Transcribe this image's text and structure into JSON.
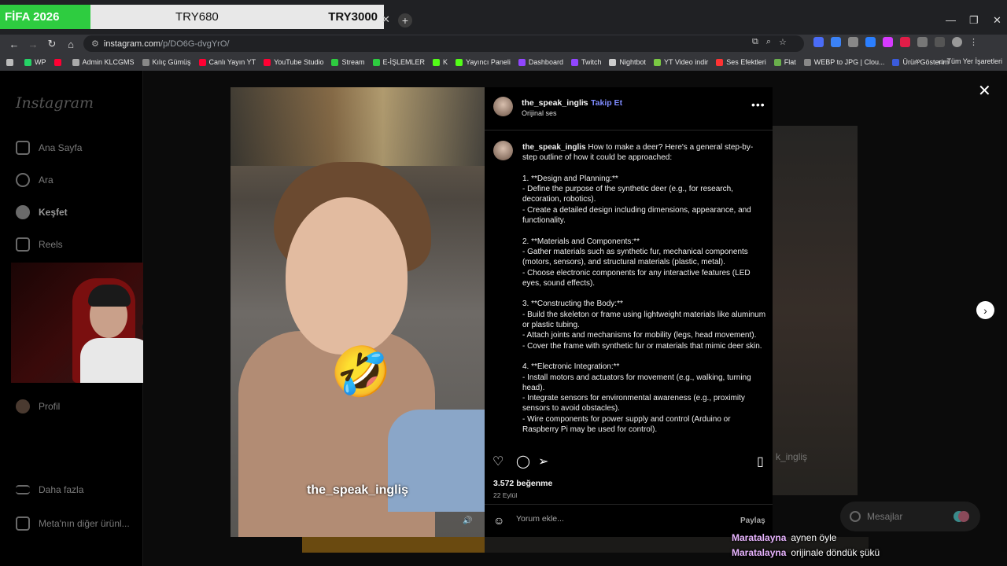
{
  "overlay": {
    "game": "FİFA 2026",
    "price1": "TRY680",
    "price2": "TRY3000"
  },
  "browser": {
    "url_host": "instagram.com",
    "url_path": "/p/DO6G-dvgYrO/",
    "bookmarks": [
      {
        "label": "WP",
        "color": "#25d366"
      },
      {
        "label": "",
        "color": "#ff0033"
      },
      {
        "label": "Admin KLCGMS",
        "color": "#aaaaaa"
      },
      {
        "label": "Kılıç Gümüş",
        "color": "#888888"
      },
      {
        "label": "Canlı Yayın YT",
        "color": "#ff0033"
      },
      {
        "label": "YouTube Studio",
        "color": "#ff0033"
      },
      {
        "label": "Stream",
        "color": "#2ecc40"
      },
      {
        "label": "E-İŞLEMLER",
        "color": "#2ecc40"
      },
      {
        "label": "K",
        "color": "#53fc18"
      },
      {
        "label": "Yayıncı Paneli",
        "color": "#53fc18"
      },
      {
        "label": "Dashboard",
        "color": "#9146ff"
      },
      {
        "label": "Twitch",
        "color": "#9146ff"
      },
      {
        "label": "Nightbot",
        "color": "#cccccc"
      },
      {
        "label": "YT Video indir",
        "color": "#7ac943"
      },
      {
        "label": "Ses Efektleri",
        "color": "#ff3333"
      },
      {
        "label": "Flat",
        "color": "#6ab04c"
      },
      {
        "label": "WEBP to JPG | Clou...",
        "color": "#888888"
      },
      {
        "label": "Ürün Gösterim",
        "color": "#3b5bdb"
      }
    ],
    "all_bookmarks": "Tüm Yer İşaretleri"
  },
  "sidebar": {
    "logo": "Instagram",
    "items": [
      {
        "label": "Ana Sayfa"
      },
      {
        "label": "Ara"
      },
      {
        "label": "Keşfet"
      },
      {
        "label": "Reels"
      },
      {
        "label": "Profil"
      },
      {
        "label": "Daha fazla"
      },
      {
        "label": "Meta'nın diğer ürünl..."
      }
    ]
  },
  "video": {
    "caption": "the_speak_ingliş",
    "emoji": "🤣"
  },
  "background_post": {
    "caption": "k_ingliş"
  },
  "post": {
    "username": "the_speak_inglis",
    "follow_label": "Takip Et",
    "dot": "•",
    "audio": "Orijinal ses",
    "more": "•••",
    "caption_user": "the_speak_inglis",
    "caption_lines": [
      "How to make a deer? Here's a general step-by-step outline of how it could be approached:",
      "",
      "1. **Design and Planning:**",
      "- Define the purpose of the synthetic deer (e.g., for research, decoration, robotics).",
      "- Create a detailed design including dimensions, appearance, and functionality.",
      "",
      "2. **Materials and Components:**",
      "- Gather materials such as synthetic fur, mechanical components (motors, sensors), and structural materials (plastic, metal).",
      "- Choose electronic components for any interactive features (LED eyes, sound effects).",
      "",
      "3. **Constructing the Body:**",
      "- Build the skeleton or frame using lightweight materials like aluminum or plastic tubing.",
      "- Attach joints and mechanisms for mobility (legs, head movement).",
      "- Cover the frame with synthetic fur or materials that mimic deer skin.",
      "",
      "4. **Electronic Integration:**",
      "- Install motors and actuators for movement (e.g., walking, turning head).",
      "- Integrate sensors for environmental awareness (e.g., proximity sensors to avoid obstacles).",
      "- Wire components for power supply and control (Arduino or Raspberry Pi may be used for control)."
    ],
    "likes": "3.572 beğenme",
    "date": "22 Eylül",
    "comment_placeholder": "Yorum ekle...",
    "share_label": "Paylaş"
  },
  "messages": {
    "label": "Mesajlar"
  },
  "chat": [
    {
      "user": "Maratalayna",
      "text": "aynen öyle"
    },
    {
      "user": "Maratalayna",
      "text": "orijinale döndük şükü"
    }
  ]
}
